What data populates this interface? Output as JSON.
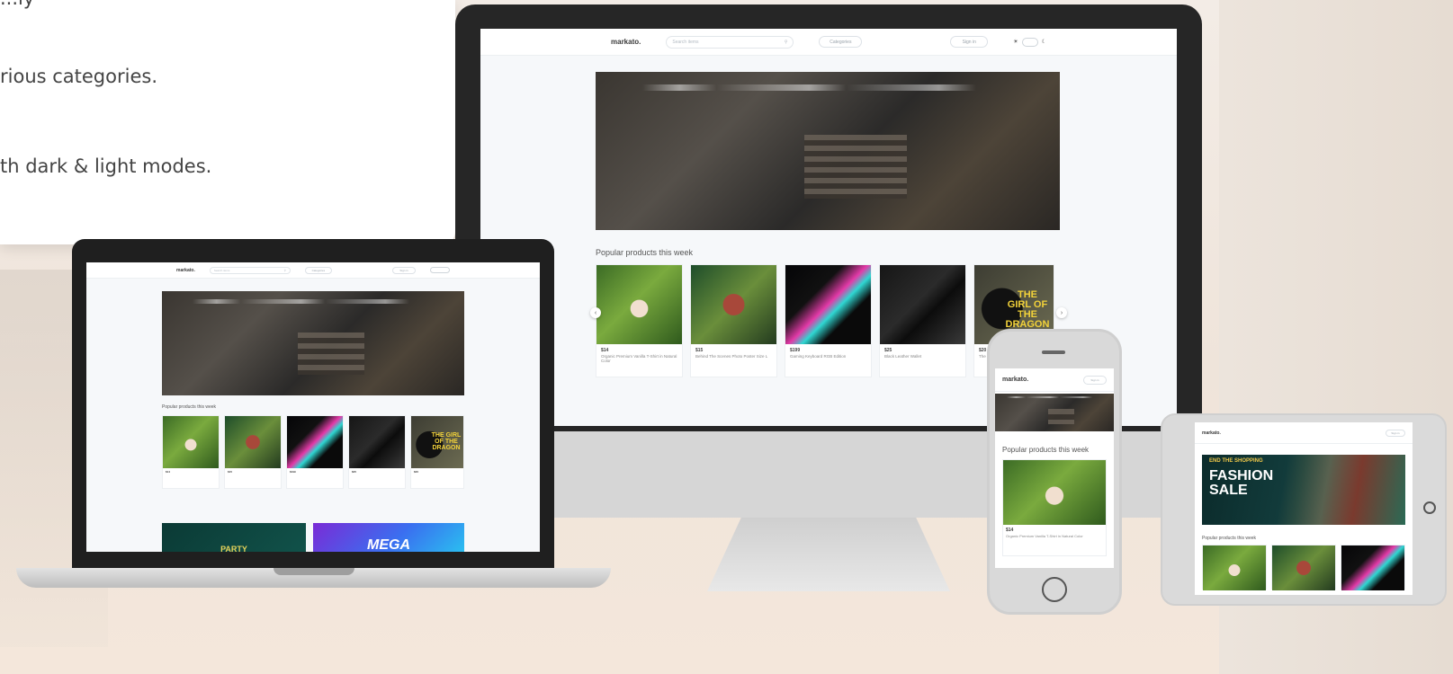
{
  "text_card": {
    "line0": "...ly",
    "line1": "rious categories.",
    "line2": "th dark & light modes."
  },
  "site": {
    "logo": "markato.",
    "search_placeholder": "Search items",
    "categories_label": "Categories",
    "signin_label": "Sign in",
    "section_title": "Popular products this week",
    "products": [
      {
        "price": "$14",
        "desc": "Organic Premium Vanilla T-Shirt in Natural Color"
      },
      {
        "price": "$15",
        "desc": "Behind The Scenes Photo Poster Size L"
      },
      {
        "price": "$199",
        "desc": "Gaming Keyboard RGB Edition"
      },
      {
        "price": "$25",
        "desc": "Black Leather Wallet"
      },
      {
        "price": "$20",
        "desc": "The Girl of the Dragon"
      }
    ],
    "book_title": "THE GIRL OF THE DRAGON"
  },
  "laptop": {
    "banner_left": "PARTY",
    "banner_right": "MEGA"
  },
  "tablet": {
    "banner_small": "END THE SHOPPING",
    "banner_big": "FASHION SALE"
  }
}
